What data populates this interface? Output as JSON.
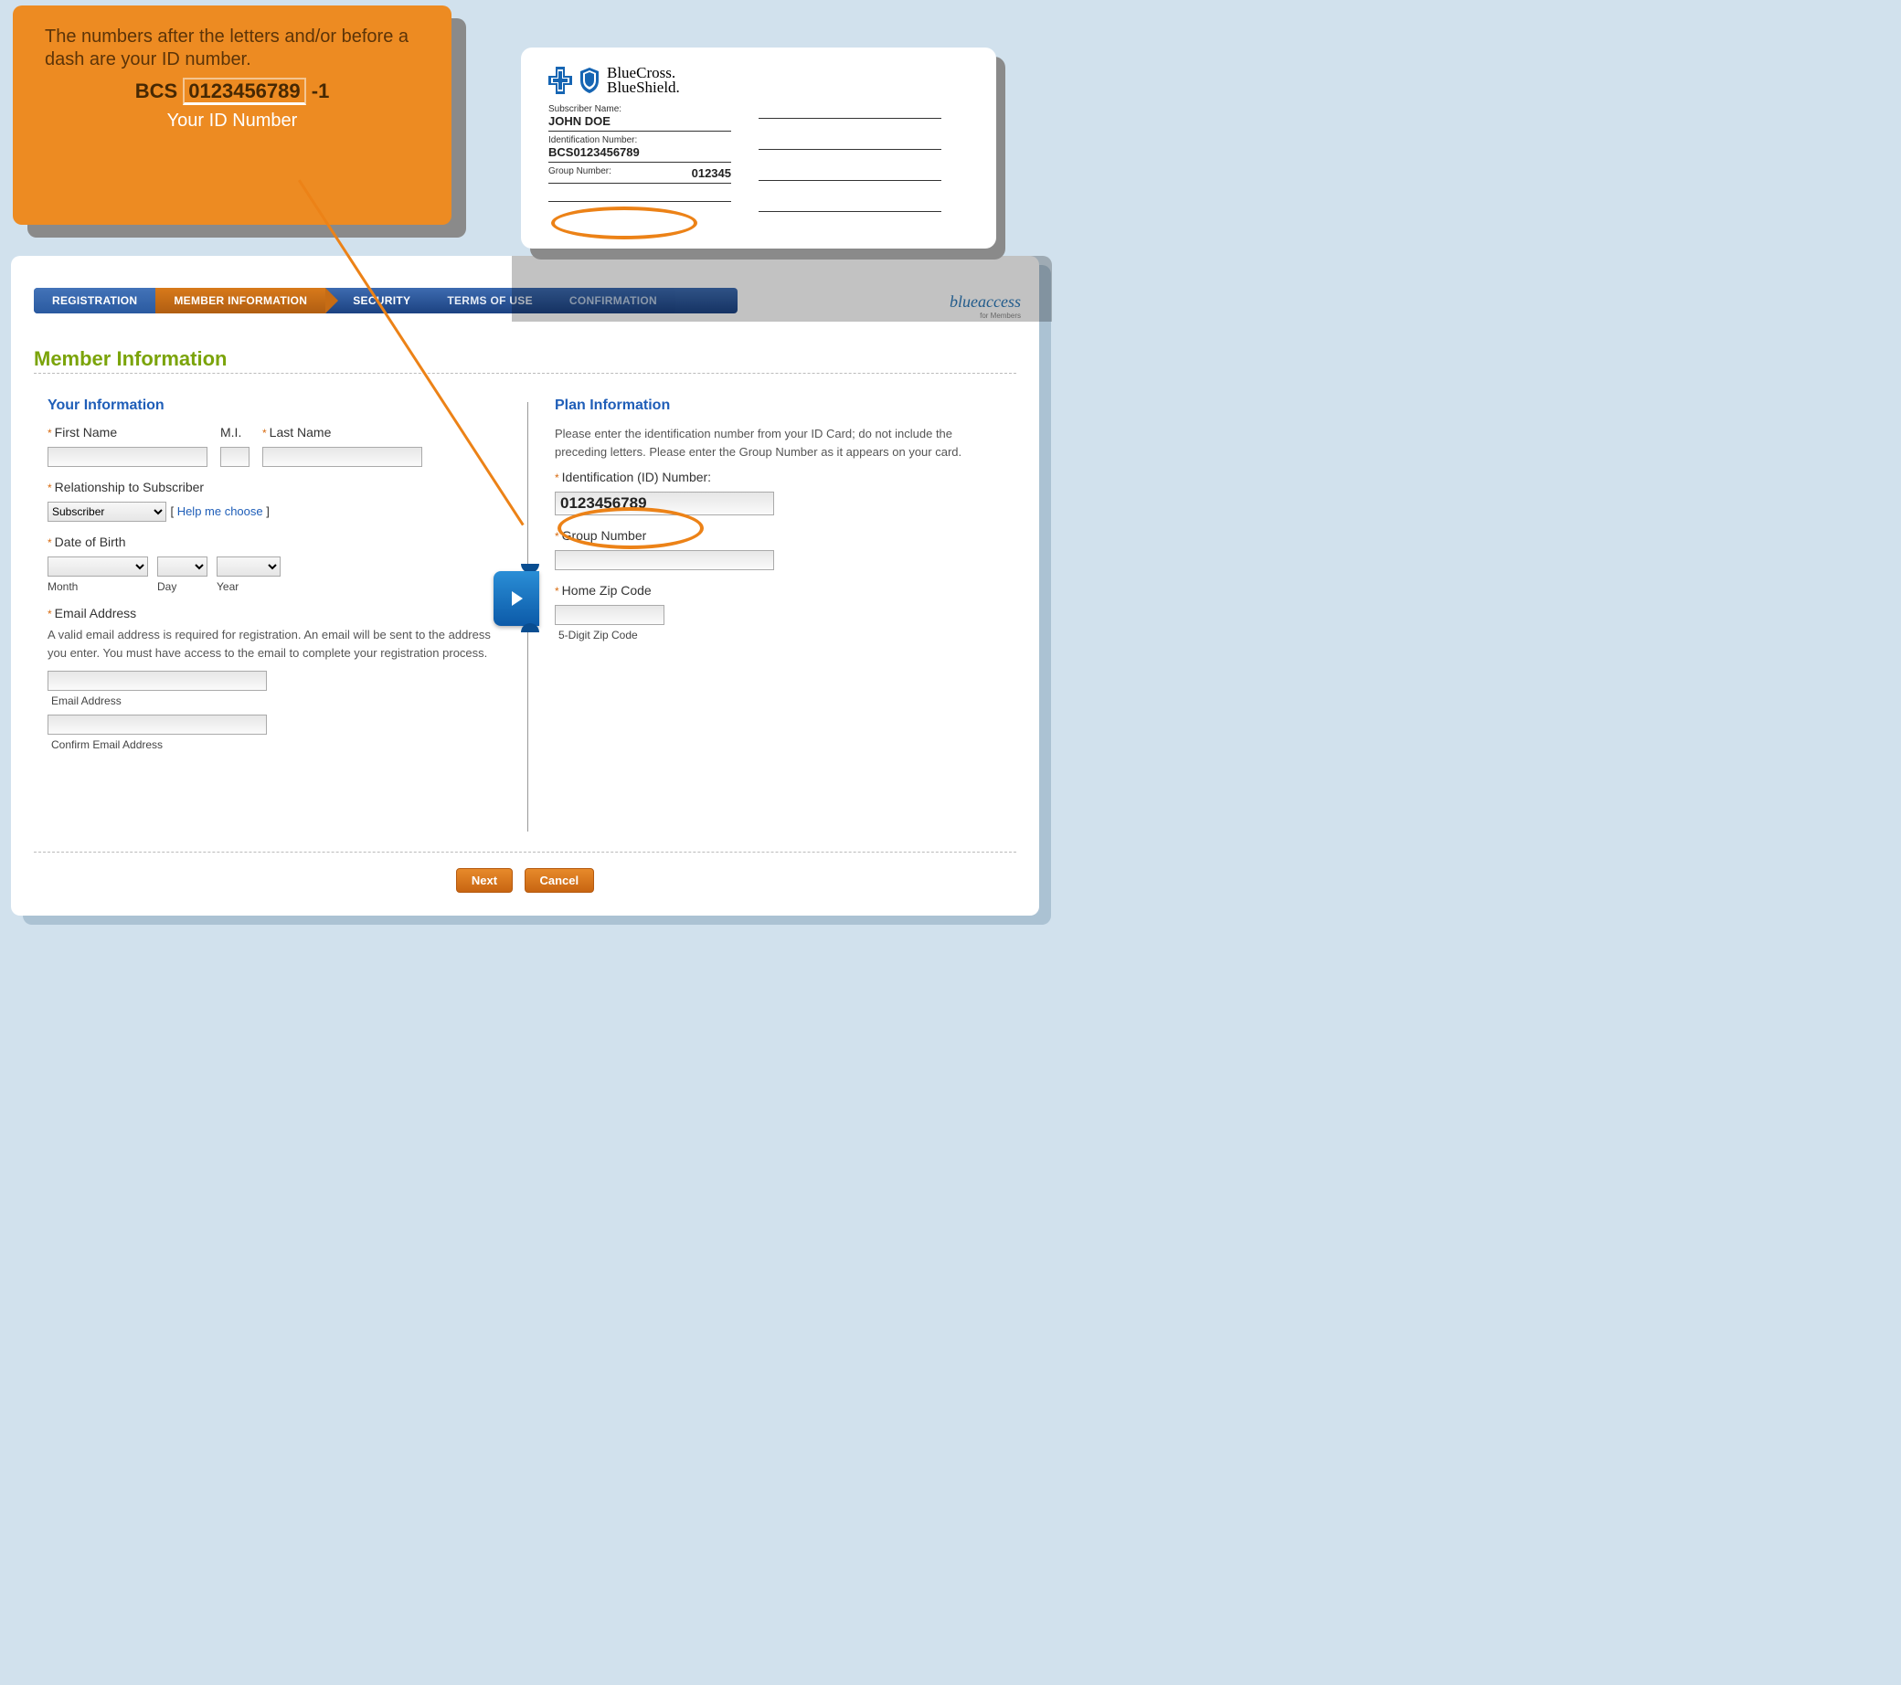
{
  "tabs": {
    "registration": "REGISTRATION",
    "member_info": "MEMBER INFORMATION",
    "security": "SECURITY",
    "terms": "TERMS OF USE",
    "confirmation": "CONFIRMATION"
  },
  "brand": {
    "blueaccess": "blueaccess",
    "blueaccess_sub": "for Members"
  },
  "page": {
    "title": "Member Information"
  },
  "your_info": {
    "heading": "Your Information",
    "first_name_label": "First Name",
    "mi_label": "M.I.",
    "last_name_label": "Last Name",
    "relationship_label": "Relationship to Subscriber",
    "relationship_value": "Subscriber",
    "help_link": "Help me choose",
    "dob_label": "Date of Birth",
    "month_hint": "Month",
    "day_hint": "Day",
    "year_hint": "Year",
    "email_label": "Email Address",
    "email_help": "A valid email address is required for registration. An email will be sent to the address you enter. You must have access to the email to complete your registration process.",
    "email_hint": "Email Address",
    "confirm_email_hint": "Confirm Email Address"
  },
  "plan_info": {
    "heading": "Plan Information",
    "instructions": "Please enter the identification number from your ID Card; do not include the preceding letters. Please enter the Group Number as it appears on your card.",
    "id_label": "Identification (ID) Number:",
    "id_value": "0123456789",
    "group_label": "Group Number",
    "zip_label": "Home Zip Code",
    "zip_hint": "5-Digit Zip Code"
  },
  "buttons": {
    "next": "Next",
    "cancel": "Cancel"
  },
  "card": {
    "brand_line1": "BlueCross.",
    "brand_line2": "BlueShield.",
    "sub_name_label": "Subscriber Name:",
    "sub_name_value": "JOHN DOE",
    "id_label": "Identification Number:",
    "id_value": "BCS0123456789",
    "group_label": "Group Number:",
    "group_value": "012345"
  },
  "tooltip": {
    "text": "The numbers after the letters and/or before a dash are your ID number.",
    "prefix": "BCS",
    "number": "0123456789",
    "suffix": "-1",
    "caption": "Your ID Number"
  }
}
